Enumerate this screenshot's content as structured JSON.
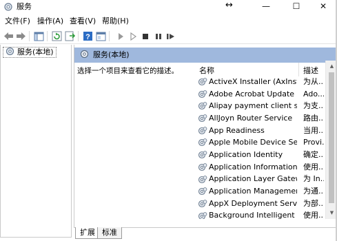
{
  "window": {
    "title": "服务",
    "minimize_glyph": "—",
    "maximize_glyph": "☐",
    "close_glyph": "✕",
    "resize_cursor_glyph": "↔"
  },
  "menu": {
    "items": [
      "文件(F)",
      "操作(A)",
      "查看(V)",
      "帮助(H)"
    ]
  },
  "toolbar": {
    "buttons": [
      "back-icon",
      "forward-icon",
      "show-hide-tree-icon",
      "refresh-icon",
      "export-list-icon",
      "help-icon",
      "properties-icon",
      "start-service-icon",
      "start-service-alt-icon",
      "stop-service-icon",
      "pause-service-icon",
      "restart-service-icon"
    ]
  },
  "tree": {
    "root_label": "服务(本地)"
  },
  "pane": {
    "header_title": "服务(本地)",
    "description_prompt": "选择一个项目来查看它的描述。"
  },
  "list": {
    "columns": {
      "name": "名称",
      "description": "描述"
    },
    "sort_indicator": "^",
    "rows": [
      {
        "name": "ActiveX Installer (AxInstSV)",
        "description": "为从..."
      },
      {
        "name": "Adobe Acrobat Update Ser...",
        "description": "Ado..."
      },
      {
        "name": "Alipay payment client secu...",
        "description": "为支..."
      },
      {
        "name": "AllJoyn Router Service",
        "description": "路由..."
      },
      {
        "name": "App Readiness",
        "description": "当用..."
      },
      {
        "name": "Apple Mobile Device Servi...",
        "description": "Provi..."
      },
      {
        "name": "Application Identity",
        "description": "确定..."
      },
      {
        "name": "Application Information",
        "description": "使用..."
      },
      {
        "name": "Application Layer Gateway ...",
        "description": "为 In..."
      },
      {
        "name": "Application Management",
        "description": "为通..."
      },
      {
        "name": "AppX Deployment Service ...",
        "description": "为部..."
      },
      {
        "name": "Background Intelligent Tra...",
        "description": "使用..."
      }
    ]
  },
  "tabs": [
    {
      "label": "扩展",
      "active": true
    },
    {
      "label": "标准",
      "active": false
    }
  ],
  "colors": {
    "pane_header": "#9fb8dd",
    "accent_blue": "#2b6cc4"
  }
}
